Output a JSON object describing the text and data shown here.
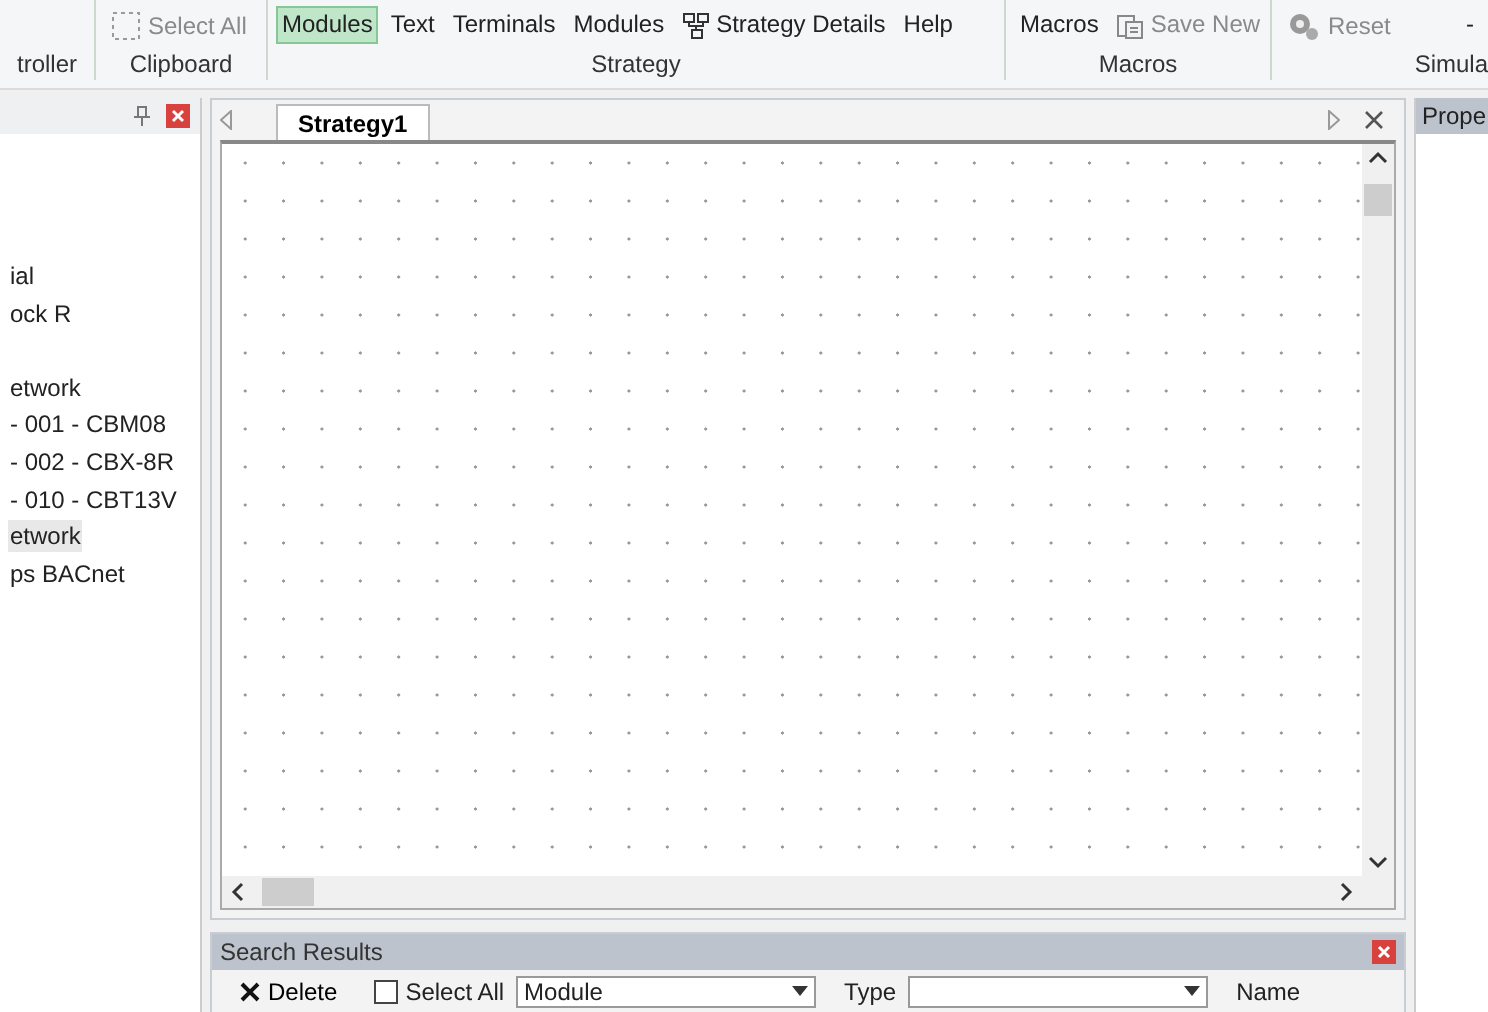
{
  "ribbon": {
    "groups": [
      {
        "label": "troller"
      },
      {
        "label": "Clipboard",
        "items": [
          {
            "label": "Select All",
            "kind": "marquee",
            "selected": false,
            "disabled": true
          }
        ]
      },
      {
        "label": "Strategy",
        "items": [
          {
            "label": "Modules",
            "kind": "plain",
            "selected": true,
            "disabled": false
          },
          {
            "label": "Text",
            "kind": "plain",
            "selected": false,
            "disabled": false
          },
          {
            "label": "Terminals",
            "kind": "plain",
            "selected": false,
            "disabled": false
          },
          {
            "label": "Modules",
            "kind": "plain",
            "selected": false,
            "disabled": false
          },
          {
            "label": "Strategy Details",
            "kind": "hierarchy",
            "selected": false,
            "disabled": false
          },
          {
            "label": "Help",
            "kind": "plain",
            "selected": false,
            "disabled": false
          }
        ]
      },
      {
        "label": "Macros",
        "items": [
          {
            "label": "Macros",
            "kind": "plain",
            "selected": false,
            "disabled": false
          },
          {
            "label": "Save New",
            "kind": "clipboard",
            "selected": false,
            "disabled": true
          }
        ]
      },
      {
        "label": "Simula",
        "items": [
          {
            "label": "Reset",
            "kind": "gear",
            "selected": false,
            "disabled": true
          },
          {
            "label": "-",
            "kind": "plain",
            "selected": false,
            "disabled": false
          }
        ]
      }
    ]
  },
  "sidebar": {
    "items": [
      {
        "label": "ial",
        "selected": false
      },
      {
        "label": "ock R",
        "selected": false
      },
      {
        "label": "etwork",
        "selected": false
      },
      {
        "label": "- 001 - CBM08",
        "selected": false
      },
      {
        "label": "- 002 - CBX-8R",
        "selected": false
      },
      {
        "label": "- 010 - CBT13V",
        "selected": false
      },
      {
        "label": "etwork",
        "selected": true
      },
      {
        "label": "ps BACnet",
        "selected": false
      }
    ]
  },
  "document": {
    "tabs": [
      {
        "label": "Strategy1",
        "selected": true
      }
    ]
  },
  "properties": {
    "title": "Prope"
  },
  "search_results": {
    "title": "Search Results",
    "delete": "Delete",
    "select_all": {
      "label": "Select All",
      "checked": false
    },
    "module_combo": {
      "value": "Module"
    },
    "type_label": "Type",
    "name_label": "Name"
  }
}
